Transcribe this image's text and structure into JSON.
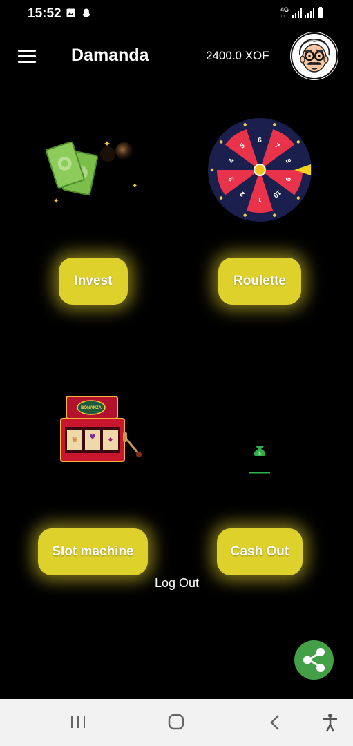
{
  "status_bar": {
    "time": "15:52",
    "network": "4G"
  },
  "app_bar": {
    "title": "Damanda",
    "balance": "2400.0 XOF"
  },
  "tiles": {
    "invest": {
      "label": "Invest"
    },
    "roulette": {
      "label": "Roulette",
      "wheel_numbers": [
        "7",
        "8",
        "9",
        "10",
        "1",
        "2",
        "3",
        "4",
        "5",
        "6"
      ]
    },
    "slot_machine": {
      "label": "Slot machine",
      "sign": "BONANZA"
    },
    "cash_out": {
      "label": "Cash Out"
    }
  },
  "logout_label": "Log Out",
  "colors": {
    "accent_yellow": "#ded12c",
    "share_green": "#43a047",
    "wheel_red": "#e8334a",
    "wheel_navy": "#1b1f4d"
  },
  "icons": {
    "menu": "hamburger-icon",
    "share": "share-icon",
    "nav": [
      "recents-icon",
      "home-icon",
      "back-icon",
      "accessibility-icon"
    ]
  }
}
